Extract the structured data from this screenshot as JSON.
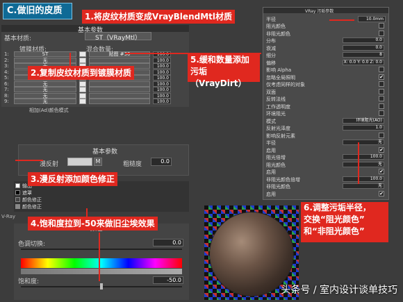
{
  "section_title": "C.做旧的皮质",
  "blend_panel": {
    "header": "基本参数",
    "base_label": "基本材质:",
    "base_value": "ST（VRayMtl）",
    "coat_label": "镀膜材质:",
    "mix_label": "混合数量:",
    "rows": [
      {
        "n": "1:",
        "mat": "ST",
        "map": "贴图 #30",
        "amount": "100.0"
      },
      {
        "n": "2:",
        "mat": "无",
        "map": "",
        "amount": "100.0"
      },
      {
        "n": "3:",
        "mat": "无",
        "map": "",
        "amount": "100.0"
      },
      {
        "n": "4:",
        "mat": "无",
        "map": "",
        "amount": "100.0"
      },
      {
        "n": "5:",
        "mat": "无",
        "map": "",
        "amount": "100.0"
      },
      {
        "n": "6:",
        "mat": "无",
        "map": "",
        "amount": "100.0"
      },
      {
        "n": "7:",
        "mat": "无",
        "map": "",
        "amount": "100.0"
      },
      {
        "n": "8:",
        "mat": "无",
        "map": "",
        "amount": "100.0"
      },
      {
        "n": "9:",
        "mat": "无",
        "map": "",
        "amount": "100.0"
      }
    ],
    "footer": "相加(Ad)颜色模式"
  },
  "basic_panel": {
    "header": "基本参数",
    "diffuse_label": "漫反射",
    "m_label": "M",
    "roughness_label": "粗糙度",
    "roughness_value": "0.0"
  },
  "list_panel": {
    "items": [
      "输出",
      "遮罩",
      "颜色修正",
      "颜色修正"
    ]
  },
  "cc_panel": {
    "vray_tab": "V-Ray",
    "header": "颜色",
    "hue_label": "色调切换:",
    "hue_value": "0.0",
    "sat_label": "饱和度:",
    "sat_value": "-50.0"
  },
  "dirt_panel": {
    "header": "VRay 污垢参数",
    "radius_label": "半径",
    "radius_value": "10.0mm",
    "rows": [
      {
        "label": "阻光颜色",
        "value": ""
      },
      {
        "label": "非阻光颜色",
        "value": ""
      },
      {
        "label": "分布",
        "value": "0.0"
      },
      {
        "label": "衰减",
        "value": "0.0"
      },
      {
        "label": "细分",
        "value": "8"
      },
      {
        "label": "偏移",
        "value": "X: 0.0  Y: 0.0  Z: 0.0"
      },
      {
        "label": "影响 Alpha",
        "value": ""
      },
      {
        "label": "忽略全局照明",
        "value": "✔"
      },
      {
        "label": "仅考虑同样的对象",
        "value": ""
      },
      {
        "label": "双面",
        "value": ""
      },
      {
        "label": "反转法线",
        "value": ""
      },
      {
        "label": "工作透明度",
        "value": ""
      },
      {
        "label": "环境阻光",
        "value": ""
      },
      {
        "label": "模式",
        "value": "环境阻光(AO)"
      },
      {
        "label": "反射光泽度",
        "value": "1.0"
      },
      {
        "label": "影响反射元素",
        "value": ""
      },
      {
        "label": "半径",
        "value": "无"
      },
      {
        "label": "启用",
        "value": "✔"
      },
      {
        "label": "阻光倍增",
        "value": "100.0"
      },
      {
        "label": "阻光颜色",
        "value": "无"
      },
      {
        "label": "启用",
        "value": "✔"
      },
      {
        "label": "非阻光颜色倍增",
        "value": "100.0"
      },
      {
        "label": "非阻光颜色",
        "value": "无"
      },
      {
        "label": "启用",
        "value": "✔"
      }
    ]
  },
  "callouts": {
    "c1": "1.将皮纹材质变成VrayBlendMtl材质",
    "c2": "2.复制皮纹材质到镀膜材质",
    "c3": "3.漫反射添加颜色修正",
    "c4": "4.饱和度拉到-50来做旧尘埃效果",
    "c5a": "5.缓和数量添加",
    "c5b": "污垢（VrayDirt）",
    "c6a": "6.调整污垢半径，",
    "c6b": "交换“阻光颜色”",
    "c6c": "和“非阻光颜色”"
  },
  "watermark": "头条号 / 室内设计谈单技巧",
  "colors": {
    "callout": "#e0281f",
    "title_bg": "#0f6a96"
  }
}
